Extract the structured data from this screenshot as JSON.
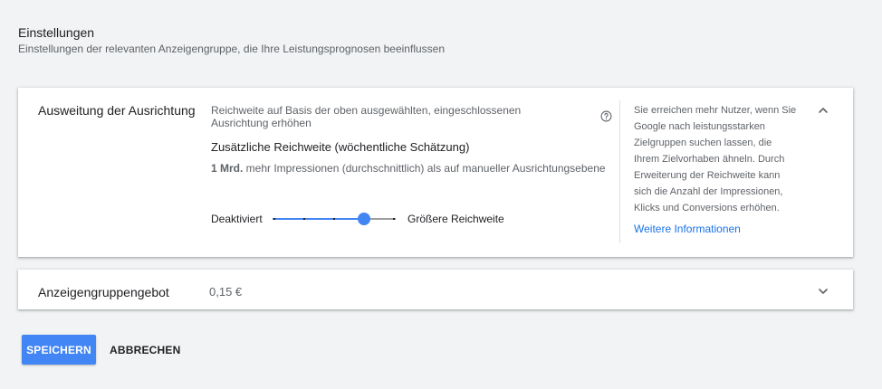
{
  "header": {
    "title": "Einstellungen",
    "subtitle": "Einstellungen der relevanten Anzeigengruppe, die Ihre Leistungsprognosen beeinflussen"
  },
  "targeting": {
    "label": "Ausweitung der Ausrichtung",
    "description": "Reichweite auf Basis der oben ausgewählten, eingeschlossenen Ausrichtung erhöhen",
    "help_icon": "help-circle-icon",
    "reach_title": "Zusätzliche Reichweite (wöchentliche Schätzung)",
    "impressions_value": "1 Mrd.",
    "impressions_text": " mehr Impressionen (durchschnittlich) als auf manueller Ausrichtungsebene",
    "slider": {
      "min_label": "Deaktiviert",
      "max_label": "Größere Reichweite",
      "steps": 5,
      "value_index": 3
    },
    "info_text": "Sie erreichen mehr Nutzer, wenn Sie Google nach leistungsstarken Zielgruppen suchen lassen, die Ihrem Zielvorhaben ähneln. Durch Erweiterung der Reichweite kann sich die Anzahl der Impressionen, Klicks und Conversions erhöhen.",
    "info_link": "Weitere Informationen",
    "expand_icon": "chevron-up-icon"
  },
  "bid": {
    "label": "Anzeigengruppengebot",
    "value": "0,15 €",
    "expand_icon": "chevron-down-icon"
  },
  "actions": {
    "save": "SPEICHERN",
    "cancel": "ABBRECHEN"
  },
  "colors": {
    "accent": "#4285f4",
    "link": "#1a73e8",
    "background": "#f1f3f4"
  }
}
